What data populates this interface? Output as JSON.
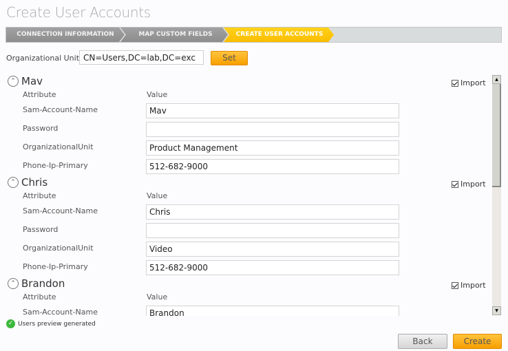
{
  "page": {
    "title": "Create User Accounts"
  },
  "wizard": {
    "steps": [
      {
        "label": "CONNECTION INFORMATION",
        "state": "completed"
      },
      {
        "label": "MAP CUSTOM FIELDS",
        "state": "completed"
      },
      {
        "label": "CREATE USER ACCOUNTS",
        "state": "active"
      }
    ]
  },
  "ou": {
    "label": "Organizational Unit",
    "value": "CN=Users,DC=lab,DC=exc",
    "set_label": "Set"
  },
  "table_headers": {
    "attribute": "Attribute",
    "value": "Value"
  },
  "import_label": "Import",
  "users": [
    {
      "name": "Mav",
      "import": true,
      "fields": [
        {
          "attribute": "Sam-Account-Name",
          "value": "Mav"
        },
        {
          "attribute": "Password",
          "value": ""
        },
        {
          "attribute": "OrganizationalUnit",
          "value": "Product Management"
        },
        {
          "attribute": "Phone-Ip-Primary",
          "value": "512-682-9000"
        }
      ]
    },
    {
      "name": "Chris",
      "import": true,
      "fields": [
        {
          "attribute": "Sam-Account-Name",
          "value": "Chris"
        },
        {
          "attribute": "Password",
          "value": ""
        },
        {
          "attribute": "OrganizationalUnit",
          "value": "Video"
        },
        {
          "attribute": "Phone-Ip-Primary",
          "value": "512-682-9000"
        }
      ]
    },
    {
      "name": "Brandon",
      "import": true,
      "fields": [
        {
          "attribute": "Sam-Account-Name",
          "value": "Brandon"
        }
      ]
    }
  ],
  "status": {
    "icon": "check-circle-icon",
    "text": "Users preview generated",
    "color": "#3cb83c"
  },
  "footer": {
    "back_label": "Back",
    "create_label": "Create"
  },
  "colors": {
    "accent": "#fbbd00",
    "button_orange": "#f79f00",
    "step_inactive": "#959595"
  }
}
